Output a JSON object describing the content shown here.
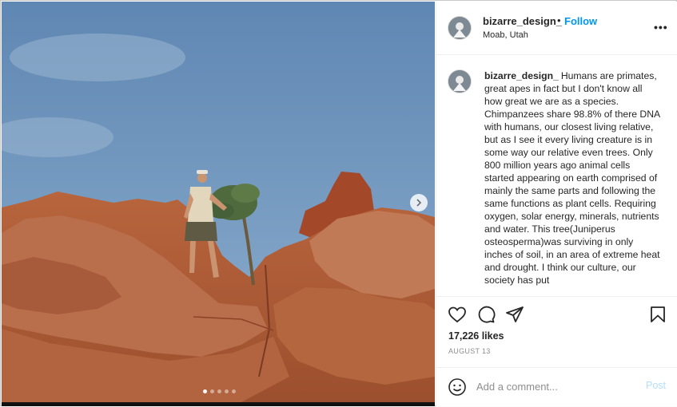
{
  "post": {
    "username": "bizarre_design_",
    "separator": "•",
    "follow_label": "Follow",
    "location": "Moab, Utah",
    "more_label": "•••",
    "caption": "Humans are primates, great apes in fact but I don't know all how great we are as a species. Chimpanzees share 98.8% of there DNA with humans, our closest living relative, but as I see it every living creature is in some way our relative even trees. Only 800 million years ago animal cells started appearing on earth comprised of mainly the same parts and following the same functions as plant cells. Requiring oxygen, solar energy, minerals, nutrients and water. This tree(Juniperus osteosperma)was surviving in only inches of soil, in an area of extreme heat and drought. I think our culture, our society has put",
    "likes": "17,226 likes",
    "date": "AUGUST 13",
    "comment_placeholder": "Add a comment...",
    "post_label": "Post"
  },
  "carousel": {
    "slides": 5,
    "active": 0
  },
  "icons": {
    "like": "heart-icon",
    "comment": "comment-icon",
    "share": "paper-plane-icon",
    "save": "bookmark-icon",
    "emoji": "smiley-icon",
    "next": "chevron-right-icon"
  },
  "colors": {
    "link": "#0095f6",
    "post_disabled": "#b2dffc",
    "text": "#262626",
    "muted": "#8e8e8e"
  }
}
